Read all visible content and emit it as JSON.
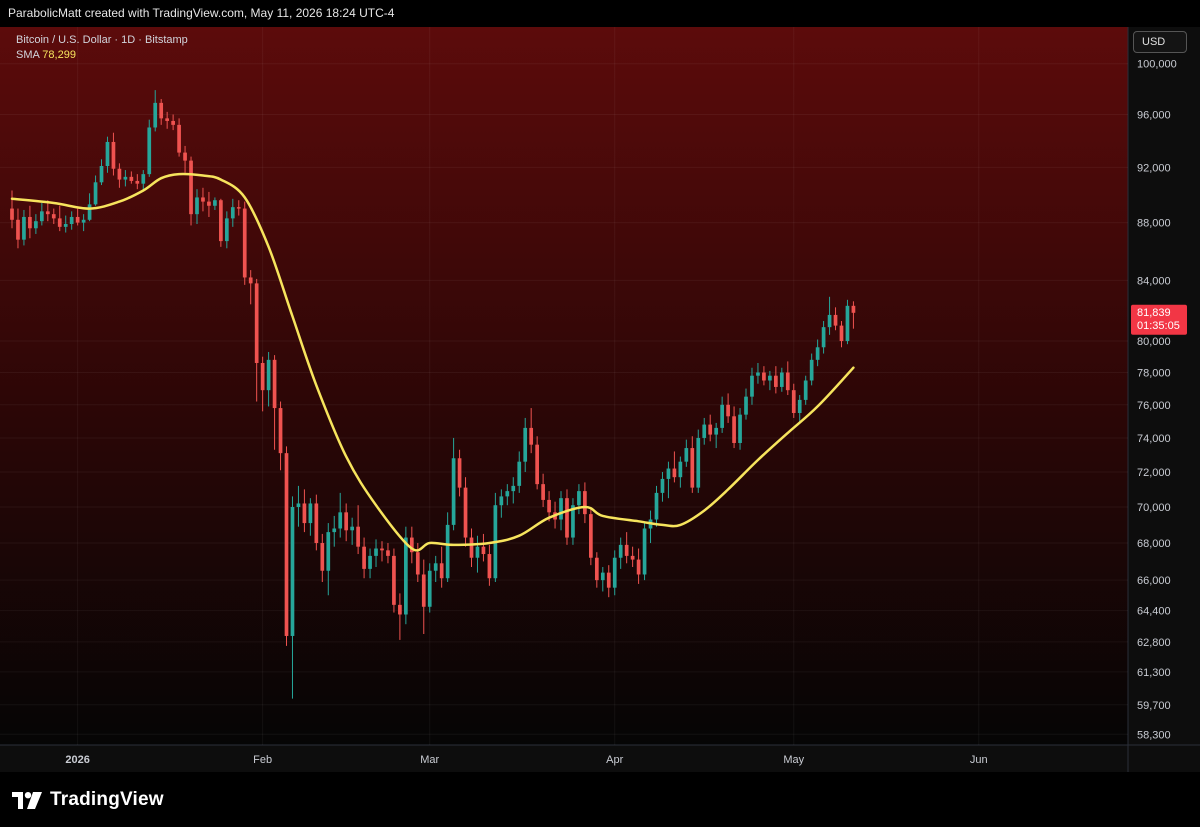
{
  "header": {
    "attribution": "ParabolicMatt created with TradingView.com, May 11, 2026 18:24 UTC-4"
  },
  "legend": {
    "symbol_line": "Bitcoin / U.S. Dollar · 1D · Bitstamp",
    "sma_label": "SMA",
    "sma_value": "78,299"
  },
  "currency_button": "USD",
  "price_tag": {
    "price": "81,839",
    "countdown": "01:35:05"
  },
  "footer": {
    "logo_text": "TradingView"
  },
  "colors": {
    "up": "#26a69a",
    "down": "#ef5350",
    "sma": "#f7e45d",
    "bg_top": "#5c0b0b",
    "bg_bottom": "#050505",
    "price_tag": "#f23645"
  },
  "chart_data": {
    "type": "candlestick",
    "title": "Bitcoin / U.S. Dollar · 1D · Bitstamp",
    "xlabel": "",
    "ylabel": "",
    "scale": "log",
    "ylim": [
      57800,
      103000
    ],
    "y_ticks": [
      100000,
      96000,
      92000,
      88000,
      84000,
      80000,
      78000,
      76000,
      74000,
      72000,
      70000,
      68000,
      66000,
      64400,
      62800,
      61300,
      59700,
      58300
    ],
    "y_tick_labels": [
      "100,000",
      "96,000",
      "92,000",
      "88,000",
      "84,000",
      "80,000",
      "78,000",
      "76,000",
      "74,000",
      "72,000",
      "70,000",
      "68,000",
      "66,000",
      "64,400",
      "62,800",
      "61,300",
      "59,700",
      "58,300"
    ],
    "x_ticks": [
      {
        "label": "2026",
        "date": "2026-01-01"
      },
      {
        "label": "Feb",
        "date": "2026-02-01"
      },
      {
        "label": "Mar",
        "date": "2026-03-01"
      },
      {
        "label": "Apr",
        "date": "2026-04-01"
      },
      {
        "label": "May",
        "date": "2026-05-01"
      },
      {
        "label": "Jun",
        "date": "2026-06-01"
      }
    ],
    "x_range": [
      "2025-12-21",
      "2026-06-24"
    ],
    "grid": true,
    "last_price": 81839,
    "sma": [
      [
        "2025-12-21",
        89700
      ],
      [
        "2025-12-28",
        89400
      ],
      [
        "2026-01-03",
        89000
      ],
      [
        "2026-01-08",
        89500
      ],
      [
        "2026-01-12",
        90300
      ],
      [
        "2026-01-15",
        91200
      ],
      [
        "2026-01-18",
        91500
      ],
      [
        "2026-01-22",
        91400
      ],
      [
        "2026-01-25",
        91100
      ],
      [
        "2026-01-29",
        89800
      ],
      [
        "2026-02-02",
        86300
      ],
      [
        "2026-02-06",
        81600
      ],
      [
        "2026-02-10",
        77200
      ],
      [
        "2026-02-15",
        72900
      ],
      [
        "2026-02-20",
        70100
      ],
      [
        "2026-02-26",
        67700
      ],
      [
        "2026-03-01",
        68000
      ],
      [
        "2026-03-05",
        67900
      ],
      [
        "2026-03-11",
        68000
      ],
      [
        "2026-03-16",
        68400
      ],
      [
        "2026-03-21",
        69400
      ],
      [
        "2026-03-27",
        70000
      ],
      [
        "2026-03-30",
        69500
      ],
      [
        "2026-04-05",
        69200
      ],
      [
        "2026-04-09",
        69000
      ],
      [
        "2026-04-12",
        69000
      ],
      [
        "2026-04-16",
        69800
      ],
      [
        "2026-04-20",
        71000
      ],
      [
        "2026-04-25",
        72700
      ],
      [
        "2026-04-30",
        74300
      ],
      [
        "2026-05-05",
        75900
      ],
      [
        "2026-05-11",
        78300
      ]
    ],
    "candles": [
      [
        "2025-12-21",
        89000,
        90300,
        87600,
        88200
      ],
      [
        "2025-12-22",
        88200,
        89000,
        86200,
        86800
      ],
      [
        "2025-12-23",
        86800,
        88900,
        86400,
        88400
      ],
      [
        "2025-12-24",
        88400,
        89200,
        86900,
        87600
      ],
      [
        "2025-12-25",
        87600,
        88600,
        87200,
        88100
      ],
      [
        "2025-12-26",
        88100,
        89400,
        87800,
        88800
      ],
      [
        "2025-12-27",
        88800,
        89600,
        88100,
        88600
      ],
      [
        "2025-12-28",
        88600,
        89000,
        87900,
        88300
      ],
      [
        "2025-12-29",
        88300,
        89200,
        87400,
        87700
      ],
      [
        "2025-12-30",
        87700,
        88500,
        87300,
        87900
      ],
      [
        "2025-12-31",
        87900,
        88800,
        87500,
        88400
      ],
      [
        "2026-01-01",
        88400,
        89000,
        87800,
        88000
      ],
      [
        "2026-01-02",
        88000,
        88600,
        87400,
        88200
      ],
      [
        "2026-01-03",
        88200,
        90100,
        88100,
        89300
      ],
      [
        "2026-01-04",
        89300,
        91400,
        89200,
        90900
      ],
      [
        "2026-01-05",
        90900,
        92600,
        90700,
        92100
      ],
      [
        "2026-01-06",
        92100,
        94300,
        91600,
        93900
      ],
      [
        "2026-01-07",
        93900,
        94600,
        91400,
        91900
      ],
      [
        "2026-01-08",
        91900,
        92300,
        90500,
        91100
      ],
      [
        "2026-01-09",
        91100,
        91800,
        90600,
        91300
      ],
      [
        "2026-01-10",
        91300,
        91700,
        90800,
        91000
      ],
      [
        "2026-01-11",
        91000,
        91500,
        90400,
        90800
      ],
      [
        "2026-01-12",
        90800,
        91800,
        90300,
        91500
      ],
      [
        "2026-01-13",
        91500,
        95600,
        91300,
        95000
      ],
      [
        "2026-01-14",
        95000,
        97900,
        94700,
        96900
      ],
      [
        "2026-01-15",
        96900,
        97200,
        95200,
        95700
      ],
      [
        "2026-01-16",
        95700,
        96200,
        94900,
        95500
      ],
      [
        "2026-01-17",
        95500,
        96000,
        94800,
        95200
      ],
      [
        "2026-01-18",
        95200,
        95700,
        92800,
        93100
      ],
      [
        "2026-01-19",
        93100,
        93600,
        91600,
        92500
      ],
      [
        "2026-01-20",
        92500,
        92800,
        87800,
        88600
      ],
      [
        "2026-01-21",
        88600,
        90400,
        87900,
        89800
      ],
      [
        "2026-01-22",
        89800,
        90500,
        88800,
        89500
      ],
      [
        "2026-01-23",
        89500,
        90200,
        88400,
        89200
      ],
      [
        "2026-01-24",
        89200,
        89800,
        88900,
        89600
      ],
      [
        "2026-01-25",
        89600,
        89700,
        86300,
        86700
      ],
      [
        "2026-01-26",
        86700,
        88800,
        86200,
        88300
      ],
      [
        "2026-01-27",
        88300,
        89700,
        87700,
        89100
      ],
      [
        "2026-01-28",
        89100,
        89600,
        88500,
        89000
      ],
      [
        "2026-01-29",
        89000,
        89500,
        83700,
        84200
      ],
      [
        "2026-01-30",
        84200,
        84700,
        82400,
        83800
      ],
      [
        "2026-01-31",
        83800,
        84100,
        76200,
        78600
      ],
      [
        "2026-02-01",
        78600,
        79000,
        75600,
        76900
      ],
      [
        "2026-02-02",
        76900,
        79300,
        75900,
        78800
      ],
      [
        "2026-02-03",
        78800,
        79100,
        73300,
        75800
      ],
      [
        "2026-02-04",
        75800,
        76200,
        72100,
        73100
      ],
      [
        "2026-02-05",
        73100,
        73500,
        62600,
        63100
      ],
      [
        "2026-02-06",
        63100,
        70600,
        60000,
        70000
      ],
      [
        "2026-02-07",
        70000,
        71200,
        68900,
        70200
      ],
      [
        "2026-02-08",
        70200,
        71000,
        68600,
        69100
      ],
      [
        "2026-02-09",
        69100,
        70500,
        68400,
        70200
      ],
      [
        "2026-02-10",
        70200,
        70700,
        67600,
        68000
      ],
      [
        "2026-02-11",
        68000,
        68500,
        65900,
        66500
      ],
      [
        "2026-02-12",
        66500,
        69100,
        65200,
        68600
      ],
      [
        "2026-02-13",
        68600,
        69500,
        67800,
        68800
      ],
      [
        "2026-02-14",
        68800,
        70800,
        68300,
        69700
      ],
      [
        "2026-02-15",
        69700,
        70200,
        68100,
        68700
      ],
      [
        "2026-02-16",
        68700,
        69400,
        67900,
        68900
      ],
      [
        "2026-02-17",
        68900,
        70100,
        67400,
        67800
      ],
      [
        "2026-02-18",
        67800,
        68300,
        66100,
        66600
      ],
      [
        "2026-02-19",
        66600,
        67700,
        66100,
        67300
      ],
      [
        "2026-02-20",
        67300,
        68200,
        66700,
        67700
      ],
      [
        "2026-02-21",
        67700,
        68100,
        67000,
        67600
      ],
      [
        "2026-02-22",
        67600,
        68000,
        66900,
        67300
      ],
      [
        "2026-02-23",
        67300,
        67700,
        64300,
        64700
      ],
      [
        "2026-02-24",
        64700,
        65300,
        62900,
        64200
      ],
      [
        "2026-02-25",
        64200,
        68900,
        63700,
        68300
      ],
      [
        "2026-02-26",
        68300,
        68900,
        66900,
        67500
      ],
      [
        "2026-02-27",
        67500,
        68000,
        65900,
        66300
      ],
      [
        "2026-02-28",
        66300,
        67100,
        63200,
        64600
      ],
      [
        "2026-03-01",
        64600,
        66900,
        64300,
        66500
      ],
      [
        "2026-03-02",
        66500,
        67300,
        65900,
        66900
      ],
      [
        "2026-03-03",
        66900,
        67800,
        65600,
        66100
      ],
      [
        "2026-03-04",
        66100,
        69700,
        65900,
        69000
      ],
      [
        "2026-03-05",
        69000,
        74000,
        68700,
        72800
      ],
      [
        "2026-03-06",
        72800,
        73300,
        70600,
        71100
      ],
      [
        "2026-03-07",
        71100,
        71700,
        67800,
        68300
      ],
      [
        "2026-03-08",
        68300,
        68800,
        66700,
        67200
      ],
      [
        "2026-03-09",
        67200,
        68400,
        66400,
        67800
      ],
      [
        "2026-03-10",
        67800,
        68500,
        67000,
        67400
      ],
      [
        "2026-03-11",
        67400,
        67900,
        65700,
        66100
      ],
      [
        "2026-03-12",
        66100,
        70800,
        65900,
        70100
      ],
      [
        "2026-03-13",
        70100,
        71000,
        69400,
        70600
      ],
      [
        "2026-03-14",
        70600,
        71300,
        70100,
        70900
      ],
      [
        "2026-03-15",
        70900,
        71700,
        70200,
        71200
      ],
      [
        "2026-03-16",
        71200,
        73200,
        70800,
        72600
      ],
      [
        "2026-03-17",
        72600,
        75200,
        72000,
        74600
      ],
      [
        "2026-03-18",
        74600,
        75800,
        73100,
        73600
      ],
      [
        "2026-03-19",
        73600,
        74100,
        71000,
        71300
      ],
      [
        "2026-03-20",
        71300,
        71900,
        70000,
        70400
      ],
      [
        "2026-03-21",
        70400,
        70900,
        69200,
        69700
      ],
      [
        "2026-03-22",
        69700,
        70300,
        68800,
        69300
      ],
      [
        "2026-03-23",
        69300,
        70900,
        68700,
        70500
      ],
      [
        "2026-03-24",
        70500,
        71000,
        67900,
        68300
      ],
      [
        "2026-03-25",
        68300,
        70500,
        67900,
        70100
      ],
      [
        "2026-03-26",
        70100,
        71300,
        69600,
        70900
      ],
      [
        "2026-03-27",
        70900,
        71400,
        69100,
        69600
      ],
      [
        "2026-03-28",
        69600,
        70000,
        66800,
        67200
      ],
      [
        "2026-03-29",
        67200,
        67500,
        65600,
        66000
      ],
      [
        "2026-03-30",
        66000,
        66700,
        65400,
        66400
      ],
      [
        "2026-03-31",
        66400,
        66800,
        65100,
        65600
      ],
      [
        "2026-04-01",
        65600,
        67600,
        65200,
        67200
      ],
      [
        "2026-04-02",
        67200,
        68300,
        66600,
        67900
      ],
      [
        "2026-04-03",
        67900,
        68600,
        66900,
        67300
      ],
      [
        "2026-04-04",
        67300,
        67800,
        66700,
        67100
      ],
      [
        "2026-04-05",
        67100,
        67700,
        65800,
        66300
      ],
      [
        "2026-04-06",
        66300,
        69100,
        66000,
        68800
      ],
      [
        "2026-04-07",
        68800,
        69800,
        68000,
        69300
      ],
      [
        "2026-04-08",
        69300,
        71200,
        68900,
        70800
      ],
      [
        "2026-04-09",
        70800,
        72000,
        70300,
        71600
      ],
      [
        "2026-04-10",
        71600,
        72600,
        70500,
        72200
      ],
      [
        "2026-04-11",
        72200,
        73200,
        71400,
        71700
      ],
      [
        "2026-04-12",
        71700,
        72900,
        71100,
        72600
      ],
      [
        "2026-04-13",
        72600,
        73900,
        72300,
        73400
      ],
      [
        "2026-04-14",
        73400,
        74100,
        70800,
        71100
      ],
      [
        "2026-04-15",
        71100,
        74500,
        70800,
        74000
      ],
      [
        "2026-04-16",
        74000,
        75200,
        73600,
        74800
      ],
      [
        "2026-04-17",
        74800,
        75400,
        73800,
        74200
      ],
      [
        "2026-04-18",
        74200,
        74900,
        73400,
        74600
      ],
      [
        "2026-04-19",
        74600,
        76500,
        74300,
        76000
      ],
      [
        "2026-04-20",
        76000,
        76700,
        74900,
        75300
      ],
      [
        "2026-04-21",
        75300,
        75900,
        73400,
        73700
      ],
      [
        "2026-04-22",
        73700,
        75800,
        73300,
        75400
      ],
      [
        "2026-04-23",
        75400,
        77000,
        75100,
        76500
      ],
      [
        "2026-04-24",
        76500,
        78300,
        76000,
        77800
      ],
      [
        "2026-04-25",
        77800,
        78600,
        77300,
        78000
      ],
      [
        "2026-04-26",
        78000,
        78400,
        77200,
        77500
      ],
      [
        "2026-04-27",
        77500,
        78100,
        76900,
        77800
      ],
      [
        "2026-04-28",
        77800,
        78400,
        76700,
        77100
      ],
      [
        "2026-04-29",
        77100,
        78300,
        76800,
        78000
      ],
      [
        "2026-04-30",
        78000,
        78700,
        76600,
        76900
      ],
      [
        "2026-05-01",
        76900,
        77300,
        75200,
        75500
      ],
      [
        "2026-05-02",
        75500,
        76600,
        74900,
        76300
      ],
      [
        "2026-05-03",
        76300,
        77800,
        76000,
        77500
      ],
      [
        "2026-05-04",
        77500,
        79200,
        77200,
        78800
      ],
      [
        "2026-05-05",
        78800,
        80100,
        78400,
        79600
      ],
      [
        "2026-05-06",
        79600,
        81300,
        79200,
        80900
      ],
      [
        "2026-05-07",
        80900,
        82900,
        80400,
        81700
      ],
      [
        "2026-05-08",
        81700,
        82200,
        80700,
        81000
      ],
      [
        "2026-05-09",
        81000,
        81300,
        79600,
        80000
      ],
      [
        "2026-05-10",
        80000,
        82700,
        79800,
        82300
      ],
      [
        "2026-05-11",
        82300,
        82600,
        80800,
        81839
      ]
    ]
  }
}
